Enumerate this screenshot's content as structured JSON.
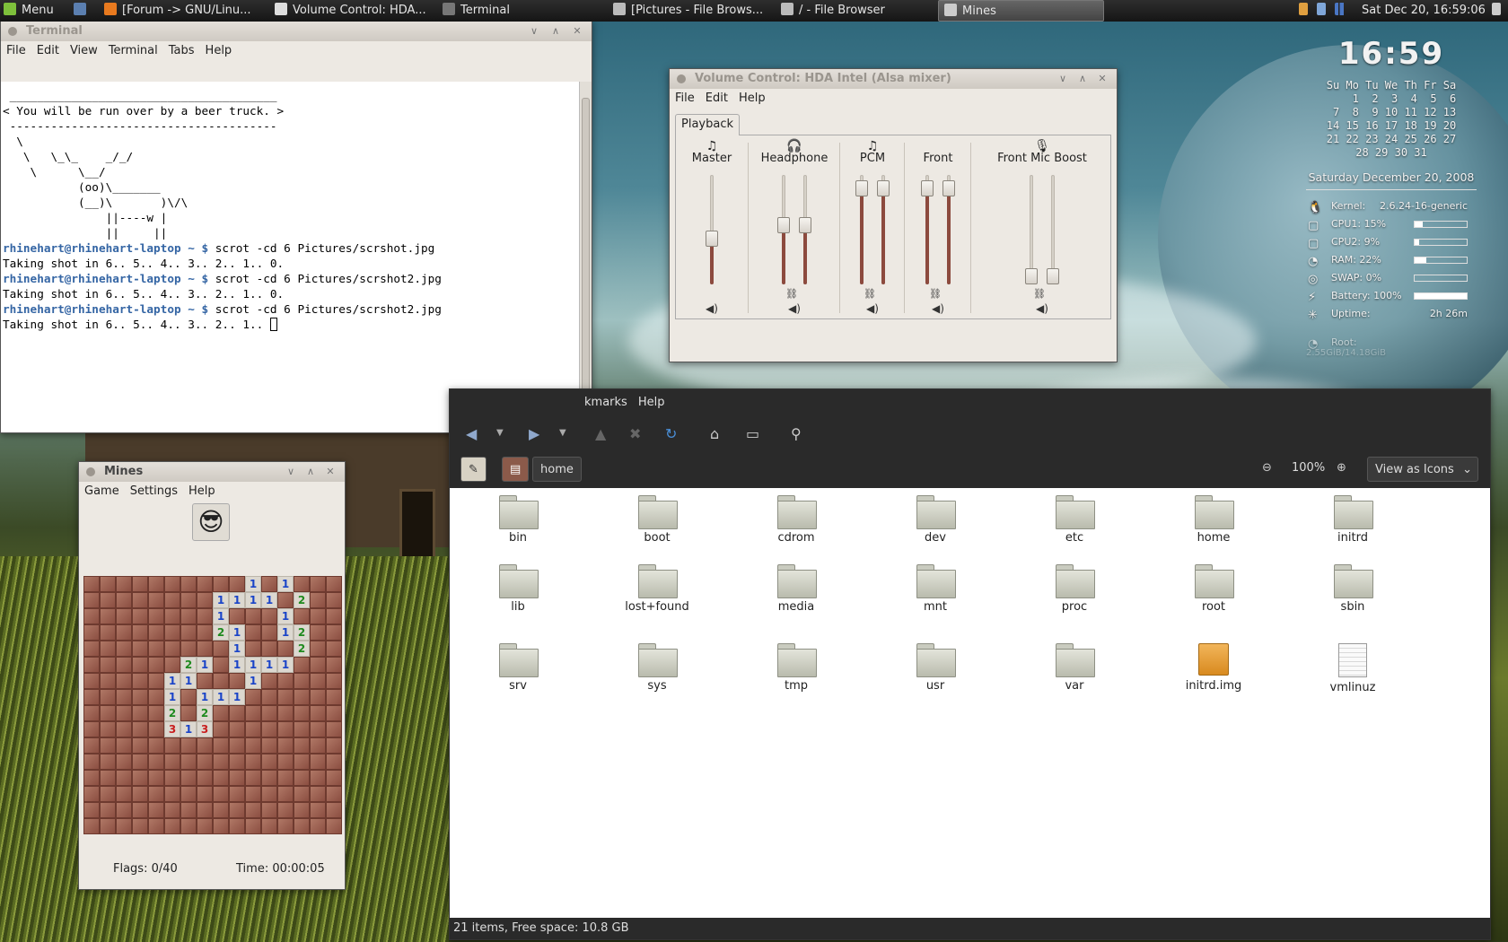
{
  "panel": {
    "menu_label": "Menu",
    "tasks": [
      "[Forum -> GNU/Linu...",
      "Volume Control: HDA...",
      "Terminal",
      "[Pictures - File Brows...",
      "/ - File Browser",
      "Mines"
    ],
    "active_task": "Mines",
    "datetime": "Sat Dec 20, 16:59:06"
  },
  "terminal": {
    "title": "Terminal",
    "menu": [
      "File",
      "Edit",
      "View",
      "Terminal",
      "Tabs",
      "Help"
    ],
    "cowsay": [
      " _______________________________________",
      "< You will be run over by a beer truck. >",
      " ---------------------------------------",
      "  \\",
      "   \\   \\_\\_    _/_/",
      "    \\      \\__/",
      "           (oo)\\_______",
      "           (__)\\       )\\/\\",
      "               ||----w |",
      "               ||     ||"
    ],
    "prompt": "rhinehart@rhinehart-laptop ~ $ ",
    "commands": [
      {
        "cmd": "scrot -cd 6 Pictures/scrshot.jpg",
        "out": "Taking shot in 6.. 5.. 4.. 3.. 2.. 1.. 0."
      },
      {
        "cmd": "scrot -cd 6 Pictures/scrshot2.jpg",
        "out": "Taking shot in 6.. 5.. 4.. 3.. 2.. 1.. 0."
      },
      {
        "cmd": "scrot -cd 6 Pictures/scrshot2.jpg",
        "out": "Taking shot in 6.. 5.. 4.. 3.. 2.. 1.. "
      }
    ]
  },
  "volume": {
    "title": "Volume Control: HDA Intel (Alsa mixer)",
    "menu": [
      "File",
      "Edit",
      "Help"
    ],
    "tab": "Playback",
    "channels": [
      {
        "name": "Master",
        "icon": "music-note-icon",
        "levels": [
          0.4
        ]
      },
      {
        "name": "Headphone",
        "icon": "headphone-icon",
        "levels": [
          0.55,
          0.55
        ]
      },
      {
        "name": "PCM",
        "icon": "music-note-icon",
        "levels": [
          0.94,
          0.94
        ]
      },
      {
        "name": "Front",
        "icon": "speaker-icon",
        "levels": [
          0.94,
          0.94
        ]
      },
      {
        "name": "Front Mic Boost",
        "icon": "microphone-icon",
        "levels": [
          0.0,
          0.0
        ]
      }
    ]
  },
  "mines": {
    "title": "Mines",
    "menu": [
      "Game",
      "Settings",
      "Help"
    ],
    "flags": "Flags: 0/40",
    "time": "Time: 00:00:05",
    "board": [
      "..........1.1...",
      "........1111.2..",
      "........1...1...",
      "........21..12..",
      ".........1...2..",
      "......21.1111...",
      ".....11...1.....",
      ".....1.111......",
      ".....2.2........",
      ".....313........",
      "................",
      "................",
      "................",
      "................",
      "................",
      "................"
    ]
  },
  "filebrowser": {
    "menu": [
      "kmarks",
      "Help"
    ],
    "path": "home",
    "zoom": "100%",
    "view": "View as Icons",
    "items": [
      {
        "name": "bin",
        "type": "folder"
      },
      {
        "name": "boot",
        "type": "folder"
      },
      {
        "name": "cdrom",
        "type": "folder"
      },
      {
        "name": "dev",
        "type": "folder"
      },
      {
        "name": "etc",
        "type": "folder"
      },
      {
        "name": "home",
        "type": "folder"
      },
      {
        "name": "initrd",
        "type": "folder"
      },
      {
        "name": "lib",
        "type": "folder"
      },
      {
        "name": "lost+found",
        "type": "folder"
      },
      {
        "name": "media",
        "type": "folder"
      },
      {
        "name": "mnt",
        "type": "folder"
      },
      {
        "name": "proc",
        "type": "folder"
      },
      {
        "name": "root",
        "type": "folder"
      },
      {
        "name": "sbin",
        "type": "folder"
      },
      {
        "name": "srv",
        "type": "folder"
      },
      {
        "name": "sys",
        "type": "folder"
      },
      {
        "name": "tmp",
        "type": "folder"
      },
      {
        "name": "usr",
        "type": "folder"
      },
      {
        "name": "var",
        "type": "folder"
      },
      {
        "name": "initrd.img",
        "type": "image"
      },
      {
        "name": "vmlinuz",
        "type": "file"
      }
    ],
    "status": "21 items, Free space: 10.8 GB"
  },
  "conky": {
    "clock": "16:59",
    "calendar": "Su Mo Tu We Th Fr Sa\n    1  2  3  4  5  6\n 7  8  9 10 11 12 13\n14 15 16 17 18 19 20\n21 22 23 24 25 26 27\n28 29 30 31",
    "date": "Saturday December 20, 2008",
    "stats": [
      {
        "label": "Kernel:",
        "value": "2.6.24-16-generic",
        "icon": "penguin-icon"
      },
      {
        "label": "CPU1: 15%",
        "bar": 0.15,
        "icon": "cpu-icon"
      },
      {
        "label": "CPU2: 9%",
        "bar": 0.09,
        "icon": "cpu-icon"
      },
      {
        "label": "RAM: 22%",
        "bar": 0.22,
        "icon": "ram-icon"
      },
      {
        "label": "SWAP: 0%",
        "bar": 0.0,
        "icon": "swap-icon"
      },
      {
        "label": "Battery: 100%",
        "bar": 1.0,
        "icon": "battery-icon"
      },
      {
        "label": "Uptime:",
        "value": "2h 26m",
        "icon": "uptime-icon"
      }
    ],
    "root_label": "Root:",
    "root_value": "2.55GiB/14.18GiB"
  }
}
